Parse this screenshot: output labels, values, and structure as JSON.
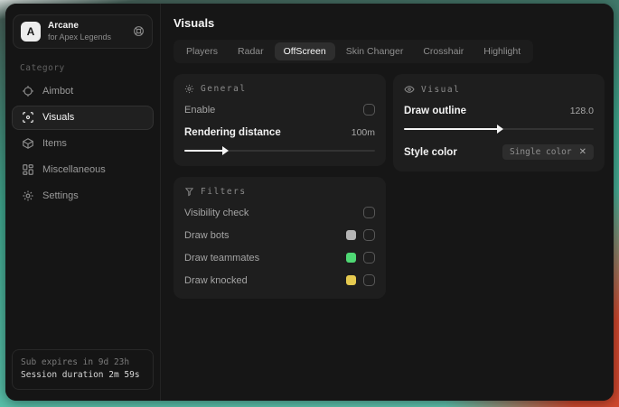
{
  "sidebar": {
    "app": {
      "logo_letter": "A",
      "title": "Arcane",
      "subtitle": "for Apex Legends"
    },
    "category_label": "Category",
    "items": [
      {
        "label": "Aimbot",
        "active": false
      },
      {
        "label": "Visuals",
        "active": true
      },
      {
        "label": "Items",
        "active": false
      },
      {
        "label": "Miscellaneous",
        "active": false
      },
      {
        "label": "Settings",
        "active": false
      }
    ],
    "footer": {
      "line1": "Sub expires in 9d 23h",
      "line2": "Session duration 2m 59s"
    }
  },
  "main": {
    "title": "Visuals",
    "tabs": [
      {
        "label": "Players",
        "active": false
      },
      {
        "label": "Radar",
        "active": false
      },
      {
        "label": "OffScreen",
        "active": true
      },
      {
        "label": "Skin Changer",
        "active": false
      },
      {
        "label": "Crosshair",
        "active": false
      },
      {
        "label": "Highlight",
        "active": false
      }
    ],
    "general": {
      "title": "General",
      "enable_label": "Enable",
      "enable_checked": false,
      "distance_label": "Rendering distance",
      "distance_value": "100m",
      "distance_fill_percent": 21
    },
    "filters": {
      "title": "Filters",
      "rows": [
        {
          "label": "Visibility check",
          "checked": false
        },
        {
          "label": "Draw bots",
          "swatch": "#b5b5b5",
          "checked": false
        },
        {
          "label": "Draw teammates",
          "swatch": "#4fd874",
          "checked": false
        },
        {
          "label": "Draw knocked",
          "swatch": "#e5c94f",
          "checked": false
        }
      ]
    },
    "visual": {
      "title": "Visual",
      "outline_label": "Draw outline",
      "outline_value": "128.0",
      "outline_fill_percent": 50,
      "style_label": "Style color",
      "style_chip": {
        "label": "Single color",
        "remove": "✕"
      }
    }
  },
  "colors": {
    "accent_green": "#4fd874",
    "accent_yellow": "#e5c94f",
    "accent_gray": "#b5b5b5",
    "bg_teal": "#3fa78e",
    "bg_red": "#d1482e"
  }
}
